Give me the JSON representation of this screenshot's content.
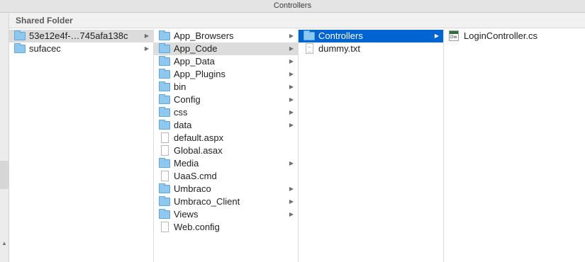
{
  "window": {
    "title": "Controllers"
  },
  "header": {
    "location": "Shared Folder"
  },
  "columns": [
    {
      "items": [
        {
          "label": "53e12e4f-…745afa138c",
          "type": "folder",
          "has_children": true,
          "state": "selected-inactive"
        },
        {
          "label": "sufacec",
          "type": "folder",
          "has_children": true,
          "state": "normal"
        }
      ]
    },
    {
      "items": [
        {
          "label": "App_Browsers",
          "type": "folder",
          "has_children": true,
          "state": "normal"
        },
        {
          "label": "App_Code",
          "type": "folder",
          "has_children": true,
          "state": "selected-inactive"
        },
        {
          "label": "App_Data",
          "type": "folder",
          "has_children": true,
          "state": "normal"
        },
        {
          "label": "App_Plugins",
          "type": "folder",
          "has_children": true,
          "state": "normal"
        },
        {
          "label": "bin",
          "type": "folder",
          "has_children": true,
          "state": "normal"
        },
        {
          "label": "Config",
          "type": "folder",
          "has_children": true,
          "state": "normal"
        },
        {
          "label": "css",
          "type": "folder",
          "has_children": true,
          "state": "normal"
        },
        {
          "label": "data",
          "type": "folder",
          "has_children": true,
          "state": "normal"
        },
        {
          "label": "default.aspx",
          "type": "file",
          "has_children": false,
          "state": "normal"
        },
        {
          "label": "Global.asax",
          "type": "file",
          "has_children": false,
          "state": "normal"
        },
        {
          "label": "Media",
          "type": "folder",
          "has_children": true,
          "state": "normal"
        },
        {
          "label": "UaaS.cmd",
          "type": "file",
          "has_children": false,
          "state": "normal"
        },
        {
          "label": "Umbraco",
          "type": "folder",
          "has_children": true,
          "state": "normal"
        },
        {
          "label": "Umbraco_Client",
          "type": "folder",
          "has_children": true,
          "state": "normal"
        },
        {
          "label": "Views",
          "type": "folder",
          "has_children": true,
          "state": "normal"
        },
        {
          "label": "Web.config",
          "type": "file",
          "has_children": false,
          "state": "normal"
        }
      ]
    },
    {
      "items": [
        {
          "label": "Controllers",
          "type": "folder",
          "has_children": true,
          "state": "selected-active"
        },
        {
          "label": "dummy.txt",
          "type": "text-file",
          "has_children": false,
          "state": "normal"
        }
      ]
    },
    {
      "items": [
        {
          "label": "LoginController.cs",
          "type": "cs-file",
          "icon_text": "Dw",
          "has_children": false,
          "state": "normal"
        }
      ]
    }
  ],
  "icons": {
    "folder": "folder-icon",
    "file": "document-icon",
    "text-file": "text-document-icon",
    "cs-file": "dreamweaver-file-icon",
    "chevron": "▶"
  },
  "colors": {
    "selection_active": "#0064d2",
    "selection_inactive": "#dcdcdc",
    "folder_fill": "#8fc8ee"
  }
}
